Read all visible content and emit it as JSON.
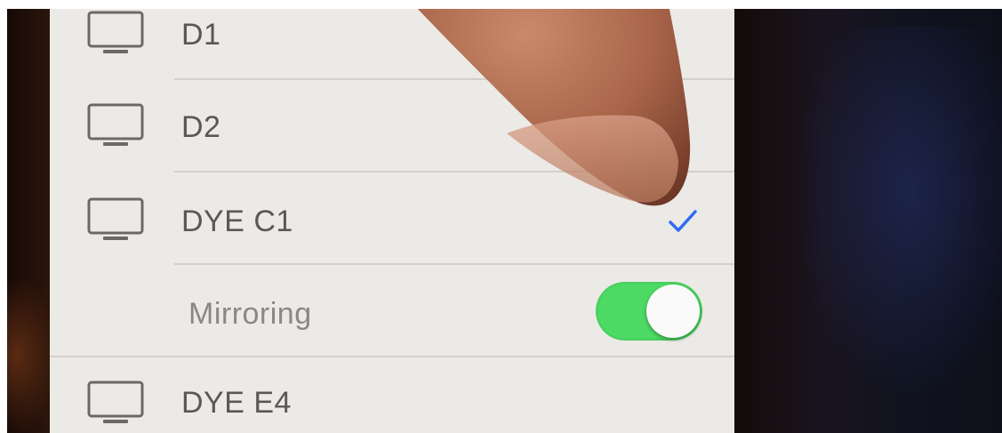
{
  "devices": [
    {
      "label": "D1",
      "icon": "tv-icon"
    },
    {
      "label": "D2",
      "icon": "tv-icon"
    },
    {
      "label": "DYE C1",
      "icon": "tv-icon",
      "selected": true
    },
    {
      "label": "DYE E4",
      "icon": "tv-icon"
    }
  ],
  "mirroring": {
    "label": "Mirroring",
    "enabled": true
  },
  "colors": {
    "panel": "#eceae6",
    "text": "#5a5856",
    "toggle_on": "#4cd964",
    "checkmark": "#2f6cf2"
  }
}
